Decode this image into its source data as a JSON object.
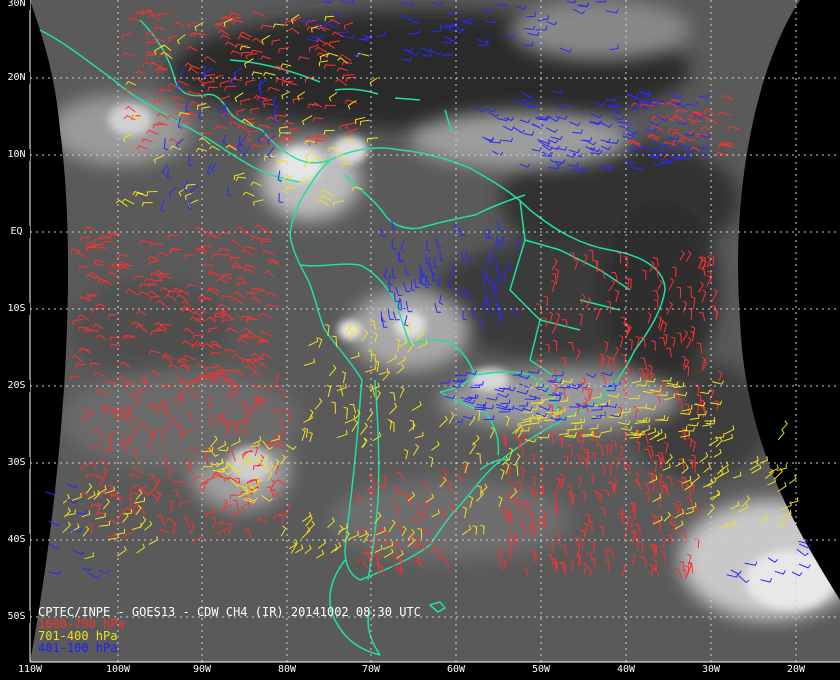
{
  "map": {
    "title": "CPTEC/INPE - GOES13 - CDW CH4 (IR) 20141002 08:30 UTC",
    "latitude_labels": [
      "30N",
      "20N",
      "10N",
      "EQ",
      "10S",
      "20S",
      "30S",
      "40S",
      "50S"
    ],
    "longitude_labels": [
      "110W",
      "100W",
      "90W",
      "80W",
      "70W",
      "60W",
      "50W",
      "40W",
      "30W",
      "20W"
    ],
    "legend": [
      {
        "label": "1000-700 hPa",
        "color": "#ff3030"
      },
      {
        "label": "701-400 hPa",
        "color": "#f0e020"
      },
      {
        "label": "401-100 hPa",
        "color": "#2020ff"
      }
    ],
    "colors": {
      "background": "#000000",
      "coastline": "#20e0a0",
      "grid": "#cccccc"
    }
  }
}
